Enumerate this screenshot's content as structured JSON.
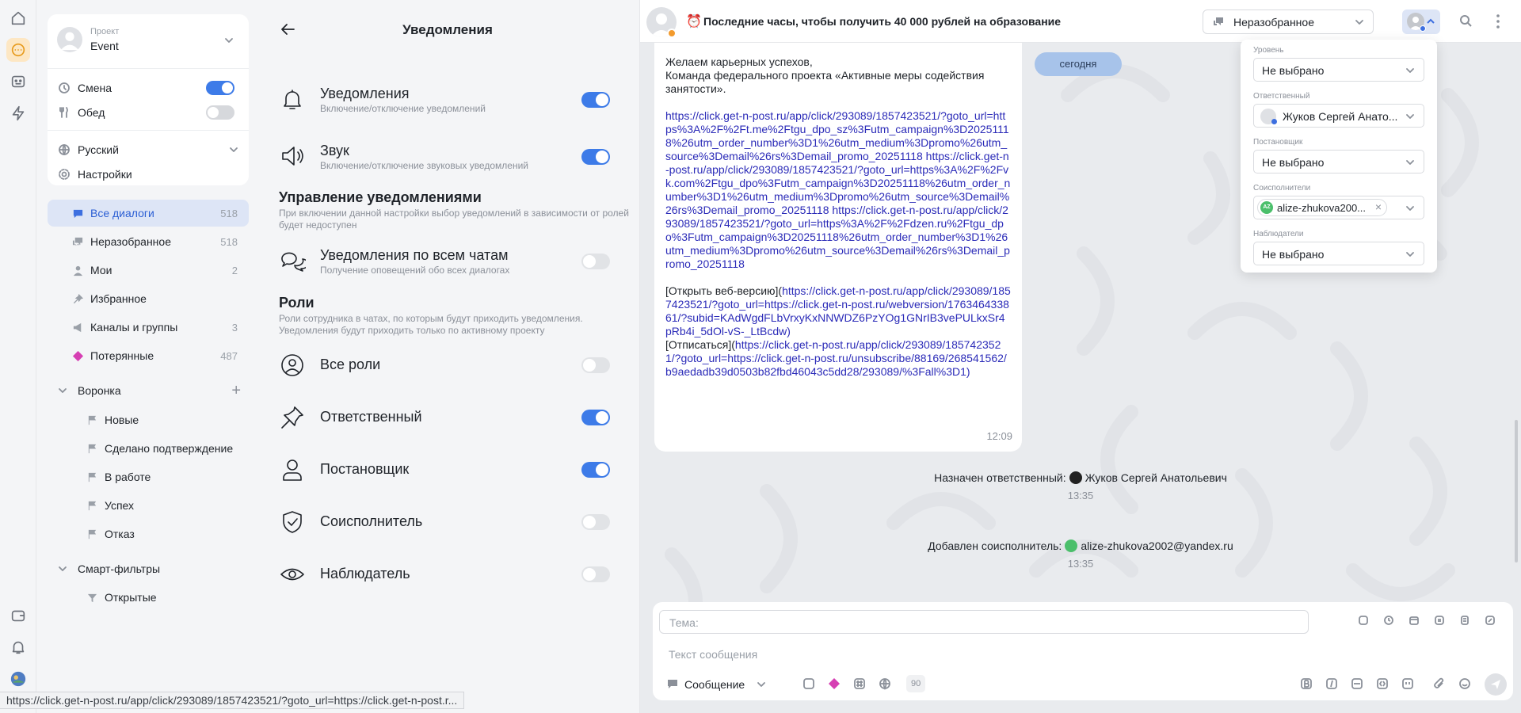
{
  "sidebar": {
    "project": {
      "caption": "Проект",
      "name": "Event"
    },
    "shift_label": "Смена",
    "lunch_label": "Обед",
    "language_label": "Русский",
    "settings_label": "Настройки",
    "nav": [
      {
        "label": "Все диалоги",
        "count": "518"
      },
      {
        "label": "Неразобранное",
        "count": "518"
      },
      {
        "label": "Мои",
        "count": "2"
      },
      {
        "label": "Избранное",
        "count": ""
      },
      {
        "label": "Каналы и группы",
        "count": "3"
      },
      {
        "label": "Потерянные",
        "count": "487"
      }
    ],
    "funnel": {
      "label": "Воронка",
      "items": [
        "Новые",
        "Сделано подтверждение",
        "В работе",
        "Успех",
        "Отказ"
      ]
    },
    "smart": {
      "label": "Смарт-фильтры",
      "items": [
        "Открытые"
      ]
    }
  },
  "notifications": {
    "title": "Уведомления",
    "rows": [
      {
        "title": "Уведомления",
        "desc": "Включение/отключение уведомлений",
        "on": true
      },
      {
        "title": "Звук",
        "desc": "Включение/отключение звуковых уведомлений",
        "on": true
      }
    ],
    "manage": {
      "title": "Управление уведомлениями",
      "desc": "При включении данной настройки выбор уведомлений в зависимости от ролей будет недоступен"
    },
    "all_chats": {
      "title": "Уведомления по всем чатам",
      "desc": "Получение оповещений обо всех диалогах",
      "on": false
    },
    "roles": {
      "title": "Роли",
      "desc": "Роли сотрудника в чатах, по которым будут приходить уведомления. Уведомления будут приходить только по активному проекту"
    },
    "role_rows": [
      {
        "title": "Все роли",
        "on": false
      },
      {
        "title": "Ответственный",
        "on": true
      },
      {
        "title": "Постановщик",
        "on": true
      },
      {
        "title": "Соисполнитель",
        "on": false
      },
      {
        "title": "Наблюдатель",
        "on": false
      }
    ]
  },
  "chat": {
    "title": "Последние часы, чтобы получить 40 000 рублей на образование",
    "folder": "Неразобранное",
    "date_pill": "сегодня",
    "message": {
      "p1": "Желаем карьерных успехов,\nКоманда федерального проекта «Активные меры содействия занятости».",
      "links": "https://click.get-n-post.ru/app/click/293089/1857423521/?goto_url=https%3A%2F%2Ft.me%2Ftgu_dpo_sz%3Futm_campaign%3D20251118%26utm_order_number%3D1%26utm_medium%3Dpromo%26utm_source%3Demail%26rs%3Demail_promo_20251118 https://click.get-n-post.ru/app/click/293089/1857423521/?goto_url=https%3A%2F%2Fvk.com%2Ftgu_dpo%3Futm_campaign%3D20251118%26utm_order_number%3D1%26utm_medium%3Dpromo%26utm_source%3Demail%26rs%3Demail_promo_20251118 https://click.get-n-post.ru/app/click/293089/1857423521/?goto_url=https%3A%2F%2Fdzen.ru%2Ftgu_dpo%3Futm_campaign%3D20251118%26utm_order_number%3D1%26utm_medium%3Dpromo%26utm_source%3Demail%26rs%3Demail_promo_20251118",
      "web_prefix": "[Открыть веб-версию](",
      "web_link": "https://click.get-n-post.ru/app/click/293089/1857423521/?goto_url=https://click.get-n-post.ru/webversion/176346433861/?subid=KAdWgdFLbVrxyKxNNWDZ6PzYOg1GNrIB3vePULkxSr4pRb4i_5dOl-vS-_LtBcdw)",
      "unsub_prefix": "[Отписаться](",
      "unsub_link": "https://click.get-n-post.ru/app/click/293089/1857423521/?goto_url=https://click.get-n-post.ru/unsubscribe/88169/268541562/b9aedadb39d0503b82fbd46043c5dd28/293089/%3Fall%3D1)",
      "time": "12:09"
    },
    "system": [
      {
        "prefix": "Назначен ответственный:",
        "name": "Жуков Сергей Анатольевич",
        "time": "13:35"
      },
      {
        "prefix": "Добавлен соисполнитель:",
        "name": "alize-zhukova2002@yandex.ru",
        "time": "13:35"
      }
    ],
    "composer": {
      "subject_placeholder": "Тема:",
      "message_placeholder": "Текст сообщения",
      "type": "Сообщение",
      "counter": "90"
    }
  },
  "assign_panel": {
    "level": {
      "caption": "Уровень",
      "value": "Не выбрано"
    },
    "responsible": {
      "caption": "Ответственный",
      "value": "Жуков Сергей Анато..."
    },
    "creator": {
      "caption": "Постановщик",
      "value": "Не выбрано"
    },
    "coexec": {
      "caption": "Соисполнители",
      "chip": "alize-zhukova200...",
      "chip_avatar": "AZ"
    },
    "observers": {
      "caption": "Наблюдатели",
      "value": "Не выбрано"
    }
  },
  "statusbar": {
    "url": "https://click.get-n-post.ru/app/click/293089/1857423521/?goto_url=https://click.get-n-post.r..."
  },
  "colors": {
    "accent": "#3d7be8",
    "active_rail": "#e79a1b",
    "date_pill": "#a7c3ea",
    "link": "#2b2bb8"
  }
}
